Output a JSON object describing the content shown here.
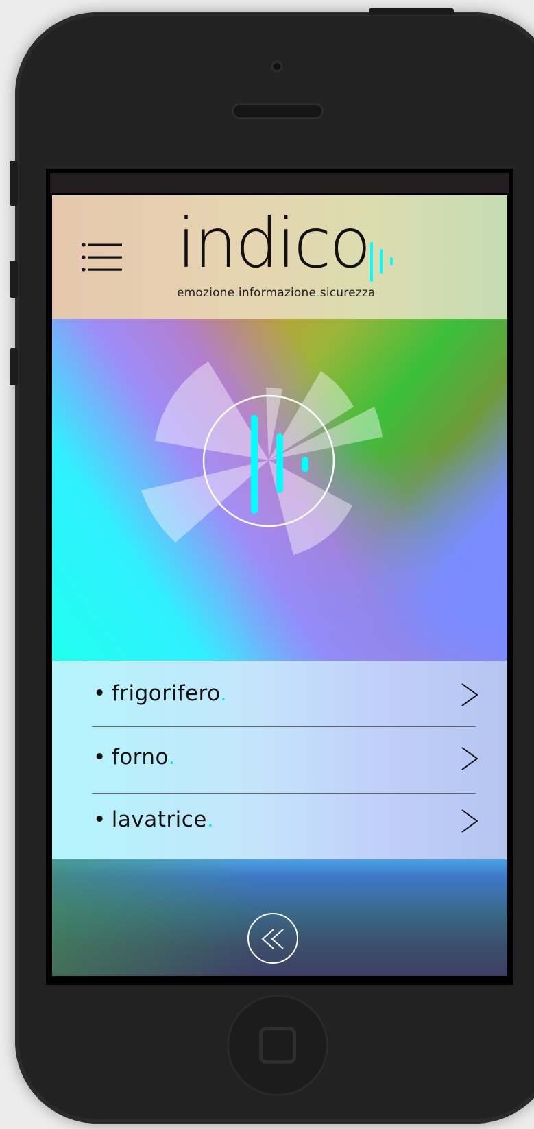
{
  "app": {
    "logo_text": "indico",
    "tagline": {
      "part1": "emozione",
      "part2": "informazione",
      "part3": "sicurezza",
      "separator": "."
    }
  },
  "colors": {
    "accent": "#00ffff",
    "text": "#111111"
  },
  "header": {
    "menu_icon": "hamburger-menu-icon"
  },
  "hero": {
    "icon": "indico-sound-bars-icon"
  },
  "list": {
    "bullet": "•",
    "accent_dot": ".",
    "items": [
      {
        "label": "frigorifero",
        "icon": "chevron-right-icon"
      },
      {
        "label": "forno",
        "icon": "chevron-right-icon"
      },
      {
        "label": "lavatrice",
        "icon": "chevron-right-icon"
      }
    ]
  },
  "footer": {
    "back_icon": "double-chevron-left-icon"
  }
}
